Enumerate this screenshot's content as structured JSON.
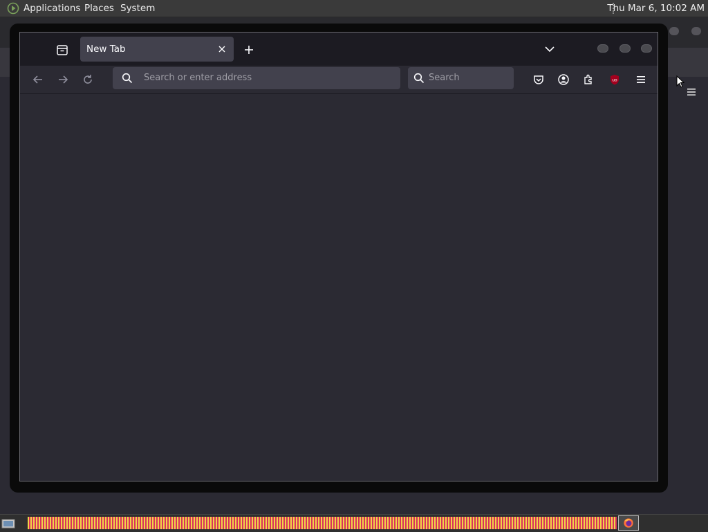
{
  "top_panel": {
    "menus": [
      "Applications",
      "Places",
      "System"
    ],
    "clock": "Thu Mar  6, 10:02 AM"
  },
  "browser": {
    "tab": {
      "title": "New Tab"
    },
    "urlbar": {
      "placeholder": "Search or enter address"
    },
    "searchbar": {
      "placeholder": "Search"
    },
    "toolbar_icons": [
      "back-icon",
      "forward-icon",
      "reload-icon",
      "pocket-icon",
      "account-icon",
      "extensions-icon",
      "ublock-origin-icon",
      "menu-icon"
    ]
  },
  "colors": {
    "content_bg": "#2b2a33",
    "tabbar_bg": "#1c1b22",
    "tab_bg": "#42414d",
    "taskbar_stripe_yellow": "#f0d44a",
    "taskbar_stripe_red": "#d9335a"
  }
}
